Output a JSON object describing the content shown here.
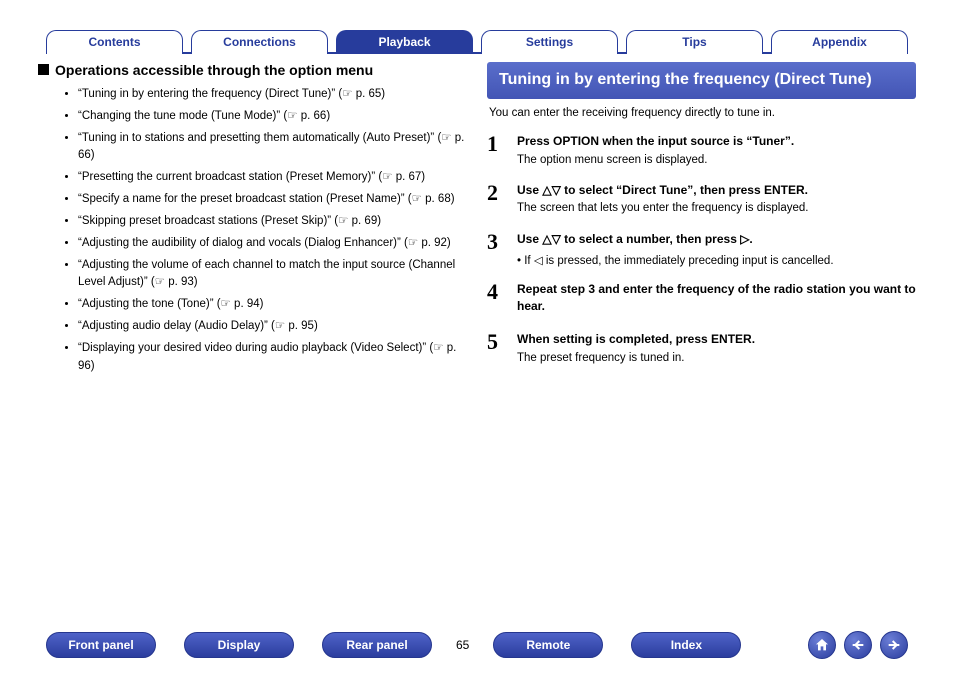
{
  "top_tabs": {
    "contents": "Contents",
    "connections": "Connections",
    "playback": "Playback",
    "settings": "Settings",
    "tips": "Tips",
    "appendix": "Appendix"
  },
  "left": {
    "heading": "Operations accessible through the option menu",
    "items": [
      "“Tuning in by entering the frequency (Direct Tune)” (☞ p. 65)",
      "“Changing the tune mode (Tune Mode)” (☞ p. 66)",
      "“Tuning in to stations and presetting them automatically (Auto Preset)” (☞ p. 66)",
      "“Presetting the current broadcast station (Preset Memory)” (☞ p. 67)",
      "“Specify a name for the preset broadcast station (Preset Name)” (☞ p. 68)",
      "“Skipping preset broadcast stations (Preset Skip)” (☞ p. 69)",
      "“Adjusting the audibility of dialog and vocals (Dialog Enhancer)” (☞ p. 92)",
      "“Adjusting the volume of each channel to match the input source (Channel Level Adjust)” (☞ p. 93)",
      "“Adjusting the tone (Tone)” (☞ p. 94)",
      "“Adjusting audio delay (Audio Delay)” (☞ p. 95)",
      "“Displaying your desired video during audio playback (Video Select)” (☞ p. 96)"
    ]
  },
  "right": {
    "title": "Tuning in by entering the frequency (Direct Tune)",
    "intro": "You can enter the receiving frequency directly to tune in.",
    "steps": [
      {
        "num": "1",
        "title": "Press OPTION when the input source is “Tuner”.",
        "note": "The option menu screen is displayed."
      },
      {
        "num": "2",
        "title": "Use △▽ to select “Direct Tune”, then press ENTER.",
        "note": "The screen that lets you enter the frequency is displayed."
      },
      {
        "num": "3",
        "title": "Use △▽ to select a number, then press ▷.",
        "sub": "If ◁ is pressed, the immediately preceding input is cancelled."
      },
      {
        "num": "4",
        "title": "Repeat step 3 and enter the frequency of the radio station you want to hear."
      },
      {
        "num": "5",
        "title": "When setting is completed, press ENTER.",
        "note": "The preset frequency is tuned in."
      }
    ]
  },
  "bottom": {
    "front_panel": "Front panel",
    "display": "Display",
    "rear_panel": "Rear panel",
    "page": "65",
    "remote": "Remote",
    "index": "Index"
  },
  "icons": {
    "home": "home-icon",
    "prev": "prev-icon",
    "next": "next-icon"
  }
}
